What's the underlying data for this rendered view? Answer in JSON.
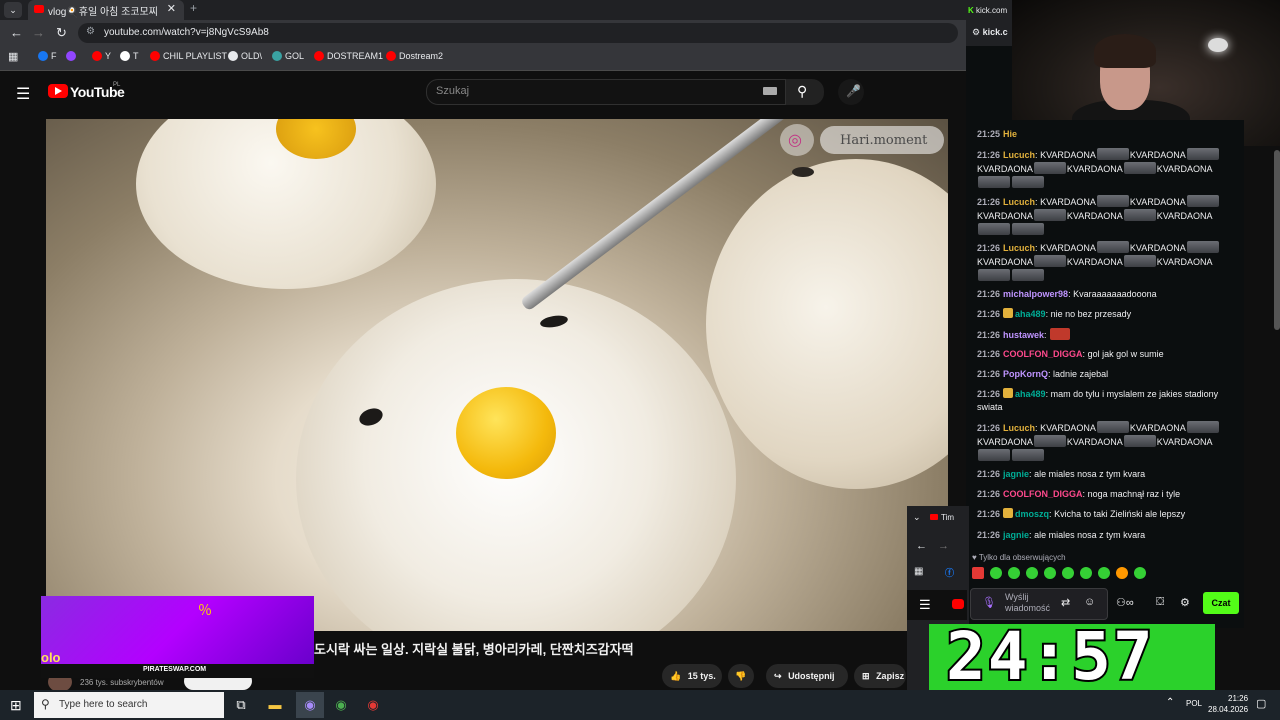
{
  "browser": {
    "tab_title": "vlog🍳휴일 아침 조코모찌",
    "tab_close": "✕",
    "new_tab": "+",
    "tab_menu": "⌄",
    "url": "youtube.com/watch?v=j8NgVcS9Ab8",
    "back": "←",
    "forward": "→",
    "reload": "↻",
    "bookmarks": [
      {
        "label": "F",
        "color": "#1877f2"
      },
      {
        "label": "",
        "color": "#9146ff"
      },
      {
        "label": "Y",
        "color": "#ff0000"
      },
      {
        "label": "T",
        "color": "#ffffff"
      },
      {
        "label": "CHIL PLAYLIST",
        "color": "#ff0000"
      },
      {
        "label": "OLD\\",
        "color": "#e8eaed"
      },
      {
        "label": "GOL",
        "color": "#3aa3a3"
      },
      {
        "label": "DOSTREAM1",
        "color": "#ff0000"
      },
      {
        "label": "Dostream2",
        "color": "#ff0000"
      }
    ]
  },
  "youtube": {
    "logo_text": "YouTube",
    "region": "PL",
    "search_placeholder": "Szukaj",
    "video_title": "도시락 싸는 일상. 지락실 불닭, 병아리카레, 단짠치즈감자떡",
    "subscribers": "236 tys. subskrybentów",
    "likes": "15 tys.",
    "share": "Udostępnij",
    "save": "Zapisz",
    "overlay_handle": "Hari.moment"
  },
  "promo": {
    "site": "PIRATESWAP.COM",
    "letters": "olo"
  },
  "kick": {
    "tab_title": "kick.com",
    "url": "kick.c",
    "chat_header_name": "Hie",
    "follow_only": "Tylko dla obserwujących",
    "input_placeholder": "Wyślij wiadomość",
    "chat_button": "Czat",
    "messages": [
      {
        "time": "21:25",
        "user": "Hie",
        "color": "#e2b13c",
        "text": "",
        "emotes": 0
      },
      {
        "time": "21:26",
        "user": "Lucuch",
        "color": "#e2b13c",
        "text": "KVARDAONA",
        "emotes": 6,
        "repeat": "KVARDAONA"
      },
      {
        "time": "21:26",
        "user": "Lucuch",
        "color": "#e2b13c",
        "text": "KVARDAONA",
        "emotes": 6,
        "repeat": "KVARDAONA"
      },
      {
        "time": "21:26",
        "user": "Lucuch",
        "color": "#e2b13c",
        "text": "KVARDAONA",
        "emotes": 6,
        "repeat": "KVARDAONA"
      },
      {
        "time": "21:26",
        "user": "michalpower98",
        "color": "#bf94ff",
        "text": "Kvaraaaaaaadooona",
        "emotes": 0
      },
      {
        "time": "21:26",
        "user": "aha489",
        "color": "#00ad96",
        "text": "nie no bez przesady",
        "emotes": 0
      },
      {
        "time": "21:26",
        "user": "hustawek",
        "color": "#bf94ff",
        "text": "",
        "emotes": 0
      },
      {
        "time": "21:26",
        "user": "COOLFON_DIGGA",
        "color": "#ff4a8d",
        "text": "gol jak gol w sumie",
        "emotes": 0
      },
      {
        "time": "21:26",
        "user": "PopKornQ",
        "color": "#bf94ff",
        "text": "ladnie zajebal",
        "emotes": 0
      },
      {
        "time": "21:26",
        "user": "aha489",
        "color": "#00ad96",
        "text": "mam do tylu i myslalem ze jakies stadiony swiata",
        "emotes": 0
      },
      {
        "time": "21:26",
        "user": "Lucuch",
        "color": "#e2b13c",
        "text": "KVARDAONA",
        "emotes": 6,
        "repeat": "KVARDAONA"
      },
      {
        "time": "21:26",
        "user": "jagnie",
        "color": "#00ad96",
        "text": "ale miales nosa z tym kvara",
        "emotes": 0
      },
      {
        "time": "21:26",
        "user": "COOLFON_DIGGA",
        "color": "#ff4a8d",
        "text": "noga machnął raz i tyle",
        "emotes": 0
      },
      {
        "time": "21:26",
        "user": "dmoszq",
        "color": "#00ad96",
        "text": "Kvicha to taki Zieliński ale lepszy",
        "emotes": 0
      },
      {
        "time": "21:26",
        "user": "jagnie",
        "color": "#00ad96",
        "text": "ale miales nosa z tym kvara",
        "emotes": 0
      }
    ]
  },
  "mini_window": {
    "tab": "Tim"
  },
  "timer": {
    "value": "24:57"
  },
  "taskbar": {
    "search_placeholder": "Type here to search",
    "lang": "POL",
    "time": "21:26",
    "date": "28.04.2026"
  }
}
